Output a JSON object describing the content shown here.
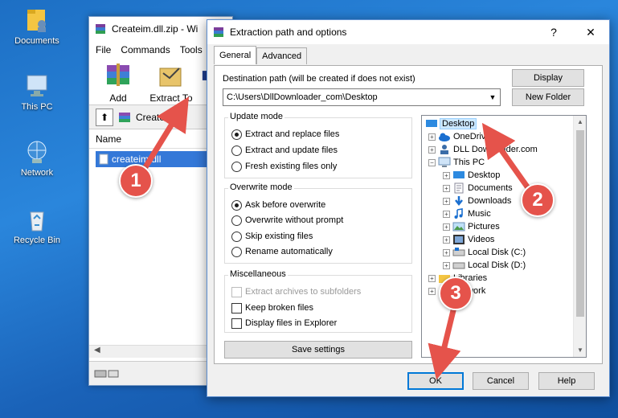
{
  "desktop": {
    "icons": [
      {
        "label": "Documents",
        "icon": "folder-user-icon"
      },
      {
        "label": "This PC",
        "icon": "computer-icon"
      },
      {
        "label": "Network",
        "icon": "network-icon"
      },
      {
        "label": "Recycle Bin",
        "icon": "recycle-bin-icon"
      }
    ]
  },
  "winrar": {
    "title": "Createim.dll.zip - Wi",
    "menu": [
      "File",
      "Commands",
      "Tools"
    ],
    "toolbar": [
      {
        "label": "Add",
        "icon": "add-archive-icon"
      },
      {
        "label": "Extract To",
        "icon": "extract-to-icon"
      },
      {
        "label": "T",
        "icon": "test-icon"
      }
    ],
    "path": "Createim.dll",
    "column_header": "Name",
    "file": "createim.dll"
  },
  "dialog": {
    "title": "Extraction path and options",
    "help_glyph": "?",
    "close_glyph": "✕",
    "tabs": [
      "General",
      "Advanced"
    ],
    "dest_label": "Destination path (will be created if does not exist)",
    "dest_value": "C:\\Users\\DllDownloader_com\\Desktop",
    "display_btn": "Display",
    "new_folder_btn": "New Folder",
    "update_mode": {
      "title": "Update mode",
      "options": [
        "Extract and replace files",
        "Extract and update files",
        "Fresh existing files only"
      ],
      "selected": 0
    },
    "overwrite_mode": {
      "title": "Overwrite mode",
      "options": [
        "Ask before overwrite",
        "Overwrite without prompt",
        "Skip existing files",
        "Rename automatically"
      ],
      "selected": 0
    },
    "misc": {
      "title": "Miscellaneous",
      "options": [
        "Extract archives to subfolders",
        "Keep broken files",
        "Display files in Explorer"
      ]
    },
    "save_settings": "Save settings",
    "tree": [
      {
        "label": "Desktop",
        "selected": true
      },
      {
        "label": "OneDrive"
      },
      {
        "label": "DLL Downloader.com"
      },
      {
        "label": "This PC"
      },
      {
        "label": "Desktop"
      },
      {
        "label": "Documents"
      },
      {
        "label": "Downloads"
      },
      {
        "label": "Music"
      },
      {
        "label": "Pictures"
      },
      {
        "label": "Videos"
      },
      {
        "label": "Local Disk (C:)"
      },
      {
        "label": "Local Disk (D:)"
      },
      {
        "label": "Libraries"
      },
      {
        "label": "Network"
      }
    ],
    "ok": "OK",
    "cancel": "Cancel",
    "help": "Help"
  },
  "annotations": [
    "1",
    "2",
    "3"
  ],
  "colors": {
    "marker": "#e5534b",
    "accent": "#0078d7",
    "desktop": "#1d6fc4"
  }
}
